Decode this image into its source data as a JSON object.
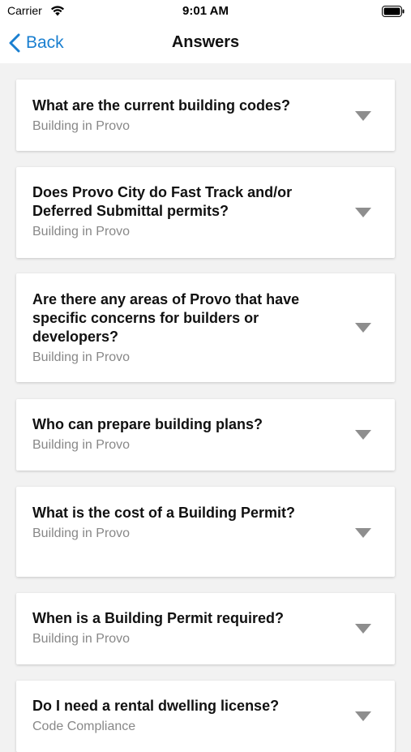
{
  "status_bar": {
    "carrier": "Carrier",
    "time": "9:01 AM"
  },
  "nav": {
    "back_label": "Back",
    "title": "Answers"
  },
  "items": [
    {
      "question": "What are the current building codes?",
      "category": "Building in Provo"
    },
    {
      "question": "Does Provo City do Fast Track and/or Deferred Submittal permits?",
      "category": "Building in Provo"
    },
    {
      "question": "Are there any areas of Provo that have specific concerns for builders or developers?",
      "category": "Building in Provo"
    },
    {
      "question": "Who can prepare building plans?",
      "category": "Building in Provo"
    },
    {
      "question": "What is the cost of a Building Permit?",
      "category": "Building in Provo"
    },
    {
      "question": "When is a Building Permit required?",
      "category": "Building in Provo"
    },
    {
      "question": "Do I need a rental dwelling license?",
      "category": "Code Compliance"
    }
  ],
  "colors": {
    "accent": "#1a7fd0",
    "background": "#f2f2f2",
    "chevron": "#8e8e8e"
  }
}
